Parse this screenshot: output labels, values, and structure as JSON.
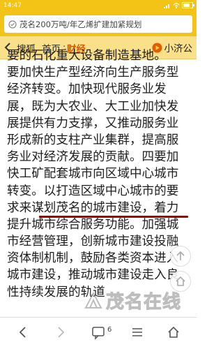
{
  "status_bar": {
    "time": "14:47"
  },
  "address_bar": {
    "text": "茂名200万吨/年乙烯扩建加紧规划"
  },
  "channel_bar": {
    "home_label": "搜狐",
    "home2_label": "首页",
    "separator": "·",
    "current_label": "财经",
    "xiaoji_label": "小济公"
  },
  "article": {
    "lines": [
      "要的石化重大设备制造基地。",
      "要加快生产型经济向生产服务型",
      "经济转变。加快现代服务业发",
      "展，既为大农业、大工业加快发",
      "展提供有力支撑，又推动服务业",
      "形成新的支柱产业集群，提高服",
      "务业对经济发展的贡献。四要加",
      "快工矿配套城市向区域中心城市",
      "转变。以打造区域中心城市的要",
      "求来谋划茂名的城市建设，着力",
      "提升城市综合服务功能。加强城",
      "市经营管理，创新城市建设投融",
      "资体制机制，鼓励各类资本进入",
      "城市建设，推动城市建设走入良",
      "性持续发展的轨道"
    ]
  },
  "bottom_bar": {
    "comment_count": "6"
  },
  "watermark": {
    "text": "茂名在线"
  },
  "colors": {
    "status_bar": "#f3c315",
    "channel_bar": "#fbe08a",
    "accent": "#d45a00",
    "underline": "#a80000"
  }
}
